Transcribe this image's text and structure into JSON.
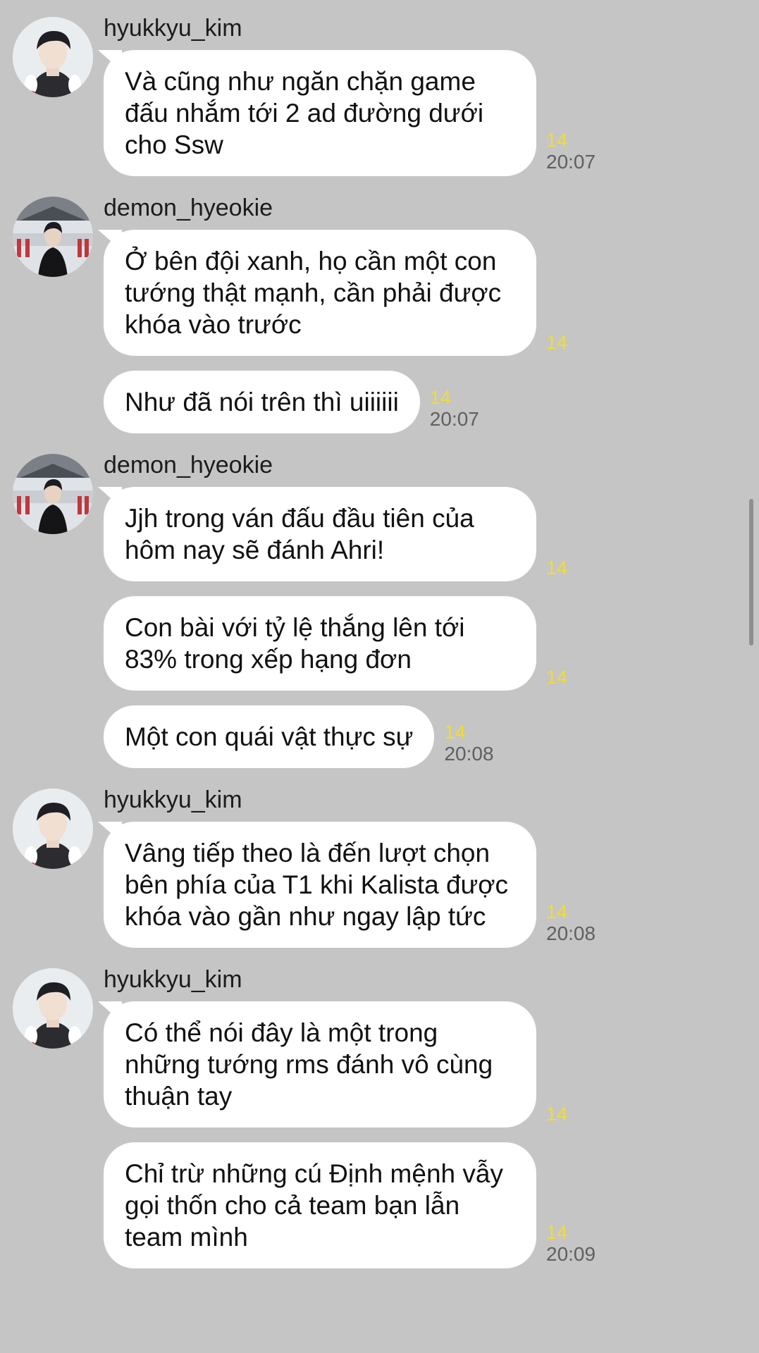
{
  "messages": [
    {
      "sender": "hyukkyu_kim",
      "bubbles": [
        {
          "text": "Và cũng như ngăn chặn game đấu nhắm tới 2 ad đường dưới cho Ssw",
          "unread": "14",
          "time": "20:07"
        }
      ]
    },
    {
      "sender": "demon_hyeokie",
      "bubbles": [
        {
          "text": "Ở bên đội xanh, họ cần một con tướng thật mạnh, cần phải được khóa vào trước",
          "unread": "14",
          "time": ""
        },
        {
          "text": "Như đã nói trên thì uiiiiii",
          "unread": "14",
          "time": "20:07"
        }
      ]
    },
    {
      "sender": "demon_hyeokie",
      "bubbles": [
        {
          "text": "Jjh trong ván đấu đầu tiên của hôm nay sẽ đánh Ahri!",
          "unread": "14",
          "time": ""
        },
        {
          "text": "Con bài với tỷ lệ thắng lên tới 83% trong xếp hạng đơn",
          "unread": "14",
          "time": ""
        },
        {
          "text": "Một con quái vật thực sự",
          "unread": "14",
          "time": "20:08"
        }
      ]
    },
    {
      "sender": "hyukkyu_kim",
      "bubbles": [
        {
          "text": "Vâng tiếp theo là đến lượt chọn bên phía của T1 khi Kalista được khóa vào gần như ngay lập tức",
          "unread": "14",
          "time": "20:08"
        }
      ]
    },
    {
      "sender": "hyukkyu_kim",
      "bubbles": [
        {
          "text": "Có thể nói đây là một trong những tướng rms đánh vô cùng thuận tay",
          "unread": "14",
          "time": ""
        },
        {
          "text": "Chỉ trừ những cú Định mệnh vẫy gọi thốn cho cả team bạn lẫn team mình",
          "unread": "14",
          "time": "20:09"
        }
      ]
    }
  ]
}
